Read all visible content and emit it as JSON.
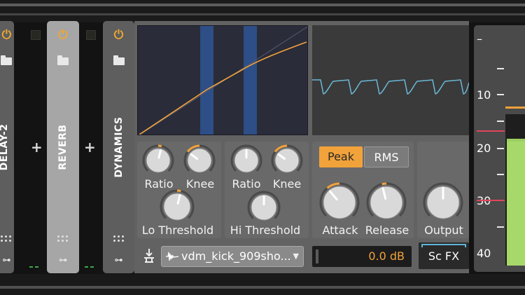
{
  "devices": [
    {
      "name": "DELAY-2"
    },
    {
      "name": "REVERB"
    },
    {
      "name": "DYNAMICS"
    }
  ],
  "add_symbol": "+",
  "knobs": {
    "lo_ratio": {
      "label": "Ratio",
      "value": 0.55
    },
    "lo_knee": {
      "label": "Knee",
      "value": 0.3
    },
    "lo_threshold": {
      "label": "Lo Threshold",
      "value": 0.55
    },
    "hi_ratio": {
      "label": "Ratio",
      "value": 0.5
    },
    "hi_knee": {
      "label": "Knee",
      "value": 0.3
    },
    "hi_threshold": {
      "label": "Hi Threshold",
      "value": 0.5
    },
    "attack": {
      "label": "Attack",
      "value": 0.35
    },
    "release": {
      "label": "Release",
      "value": 0.45
    },
    "output": {
      "label": "Output",
      "value": 0.5
    }
  },
  "detection": {
    "peak_label": "Peak",
    "rms_label": "RMS",
    "selected": "Peak"
  },
  "sidechain": {
    "source": "vdm_kick_909sho...",
    "gain": "0.0 dB",
    "fx_label": "Sc FX"
  },
  "meter": {
    "scale": [
      "–",
      "10",
      "20",
      "30",
      "40"
    ]
  },
  "colors": {
    "accent": "#f2a23a",
    "band": "#2d4e86",
    "meter_green": "#a6d96a",
    "threshold_red": "#e0465a",
    "scope_line": "#6ab8d8"
  }
}
